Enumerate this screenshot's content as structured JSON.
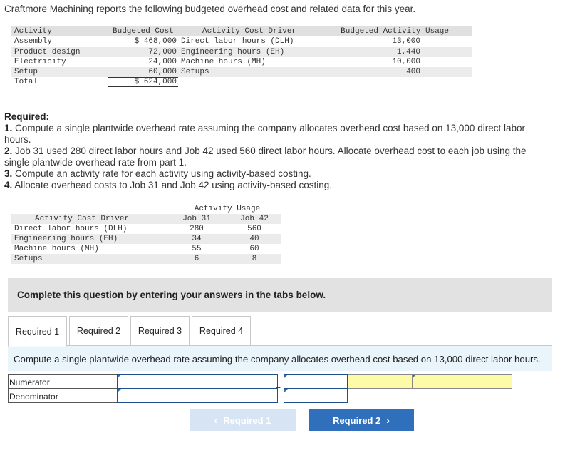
{
  "intro": "Craftmore Machining reports the following budgeted overhead cost and related data for this year.",
  "table1": {
    "headers": {
      "activity": "Activity",
      "budgeted_cost": "Budgeted Cost",
      "driver": "Activity Cost Driver",
      "usage": "Budgeted Activity Usage"
    },
    "rows": [
      {
        "activity": "Assembly",
        "cost": "$ 468,000",
        "driver": "Direct labor hours (DLH)",
        "usage": "13,000"
      },
      {
        "activity": "Product design",
        "cost": "72,000",
        "driver": "Engineering hours (EH)",
        "usage": "1,440"
      },
      {
        "activity": "Electricity",
        "cost": "24,000",
        "driver": "Machine hours (MH)",
        "usage": "10,000"
      },
      {
        "activity": "Setup",
        "cost": "60,000",
        "driver": "Setups",
        "usage": "400"
      }
    ],
    "total": {
      "label": "Total",
      "cost": "$ 624,000"
    }
  },
  "required": {
    "heading": "Required:",
    "items": [
      {
        "num": "1.",
        "text": "Compute a single plantwide overhead rate assuming the company allocates overhead cost based on 13,000 direct labor hours."
      },
      {
        "num": "2.",
        "text": "Job 31 used 280 direct labor hours and Job 42 used 560 direct labor hours. Allocate overhead cost to each job using the single plantwide overhead rate from part 1."
      },
      {
        "num": "3.",
        "text": "Compute an activity rate for each activity using activity-based costing."
      },
      {
        "num": "4.",
        "text": "Allocate overhead costs to Job 31 and Job 42 using activity-based costing."
      }
    ]
  },
  "table2": {
    "group_header": "Activity Usage",
    "headers": {
      "driver": "Activity Cost Driver",
      "job31": "Job 31",
      "job42": "Job 42"
    },
    "rows": [
      {
        "driver": "Direct labor hours (DLH)",
        "job31": "280",
        "job42": "560"
      },
      {
        "driver": "Engineering hours (EH)",
        "job31": "34",
        "job42": "40"
      },
      {
        "driver": "Machine hours (MH)",
        "job31": "55",
        "job42": "60"
      },
      {
        "driver": "Setups",
        "job31": "6",
        "job42": "8"
      }
    ]
  },
  "banner": "Complete this question by entering your answers in the tabs below.",
  "tabs": [
    "Required 1",
    "Required 2",
    "Required 3",
    "Required 4"
  ],
  "panel_instruction": "Compute a single plantwide overhead rate assuming the company allocates overhead cost based on 13,000 direct labor hours.",
  "grid": {
    "numerator_label": "Numerator",
    "denominator_label": "Denominator",
    "equals": "="
  },
  "nav": {
    "prev": "Required 1",
    "next": "Required 2"
  }
}
